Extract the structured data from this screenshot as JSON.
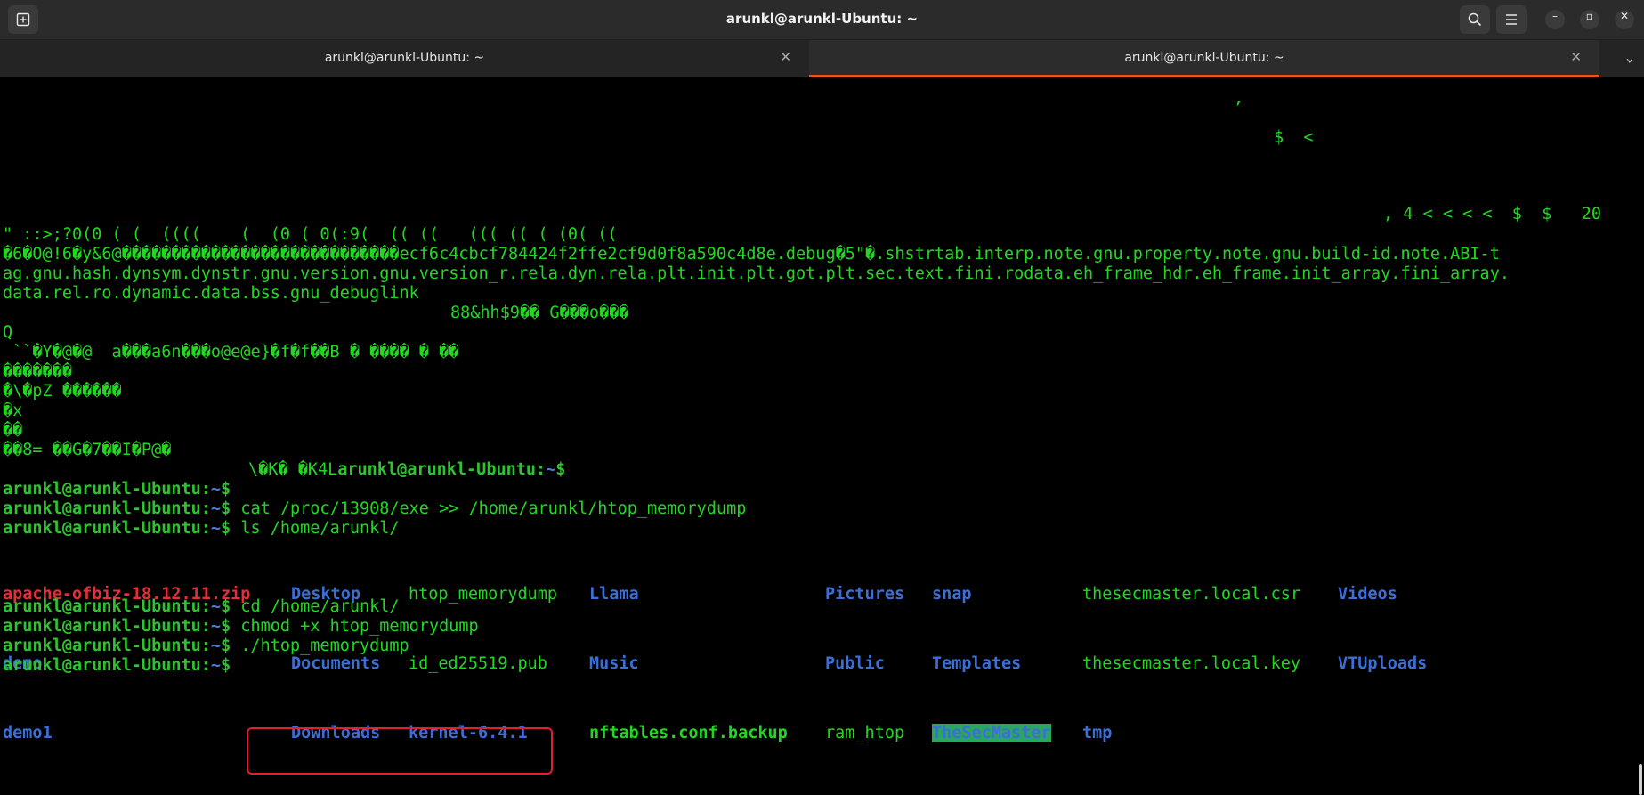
{
  "window": {
    "title": "arunkl@arunkl-Ubuntu: ~",
    "new_tab_icon": "new-tab-icon",
    "search_icon": "search-icon",
    "menu_icon": "hamburger-menu-icon",
    "minimize": "–",
    "maximize": "▫",
    "close": "✕"
  },
  "tabs": [
    {
      "label": "arunkl@arunkl-Ubuntu: ~",
      "close": "✕",
      "active": false
    },
    {
      "label": "arunkl@arunkl-Ubuntu: ~",
      "close": "✕",
      "active": true
    }
  ],
  "tab_menu": "⌄",
  "prompt": {
    "user": "arunkl@arunkl-Ubuntu",
    "cwd": "~",
    "sign": "$"
  },
  "binary_lines": [
    ",",
    "$  <",
    ", 4 < < < <  $  $   20",
    "\" ::>;?0(0 ( (  ((((    (  (0 ( 0(:9(  (( ((   ((( (( ( (0( ((",
    "�6�O@!6�y&6@����������������������������ecf6c4cbcf784424f2ffe2cf9d0f8a590c4d8e.debug�5\"�.shstrtab.interp.note.gnu.property.note.gnu.build-id.note.ABI-t",
    "ag.gnu.hash.dynsym.dynstr.gnu.version.gnu.version_r.rela.dyn.rela.plt.init.plt.got.plt.sec.text.fini.rodata.eh_frame_hdr.eh_frame.init_array.fini_array.",
    "data.rel.ro.dynamic.data.bss.gnu_debuglink",
    "88&hh$9�� G���o���",
    "Q",
    " ``�Y�@�@  a���a6n���o@e@e}�f�f��B � ���� � ��",
    "�������",
    "�\\�pZ ������",
    "�x",
    "��",
    "��8= ��G�7��I�P@�",
    "\\�K� �K4L"
  ],
  "commands": [
    "",
    "cat /proc/13908/exe >> /home/arunkl/htop_memorydump",
    "ls /home/arunkl/",
    "cd /home/arunkl/",
    "chmod +x htop_memorydump",
    "./htop_memorydump",
    ""
  ],
  "ls_output": {
    "col1": [
      "apache-ofbiz-18.12.11.zip",
      "demo",
      "demo1"
    ],
    "col2": [
      "Desktop",
      "Documents",
      "Downloads"
    ],
    "col3": [
      "htop_memorydump",
      "id_ed25519.pub",
      "kernel-6.4.1"
    ],
    "col4": [
      "Llama",
      "Music",
      "nftables.conf.backup"
    ],
    "col5": [
      "Pictures",
      "Public",
      "ram_htop"
    ],
    "col6": [
      "snap",
      "Templates",
      "TheSecMaster"
    ],
    "col7": [
      "thesecmaster.local.csr",
      "thesecmaster.local.key",
      "tmp"
    ],
    "col8": [
      "Videos",
      "VTUploads",
      ""
    ]
  },
  "colors": {
    "prompt_green": "#2fc42f",
    "dir_blue": "#3c6fd6",
    "zip_red": "#e0303a",
    "accent": "#e95420"
  }
}
